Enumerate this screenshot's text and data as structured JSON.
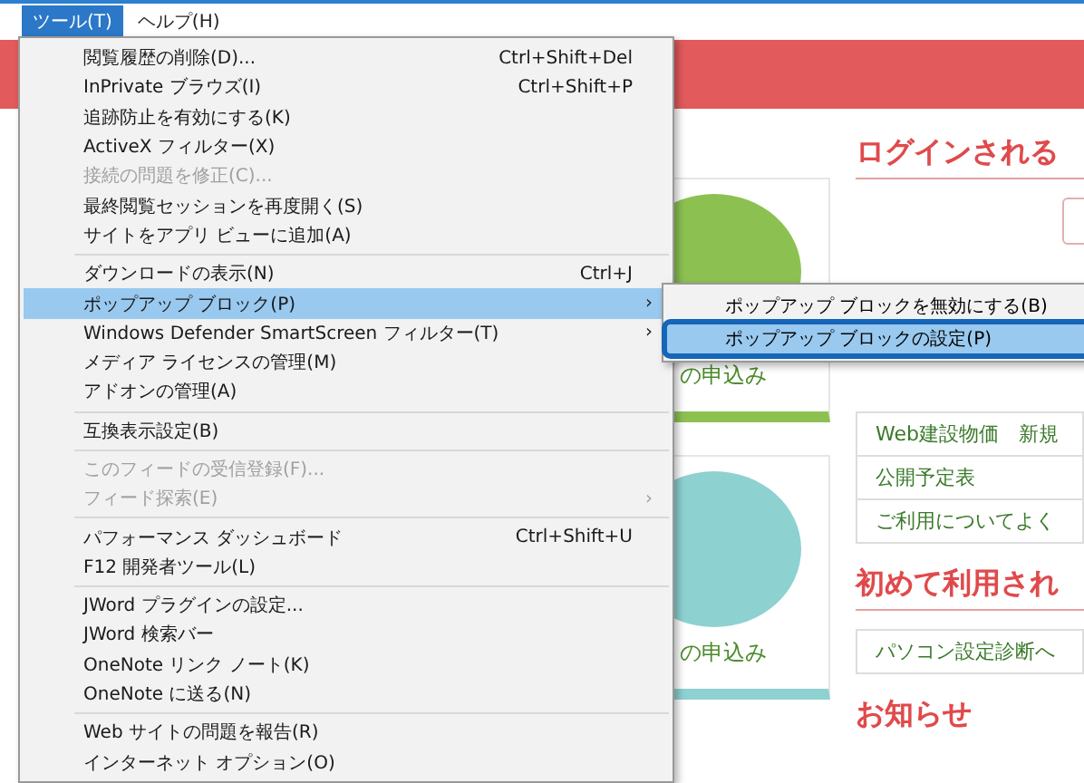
{
  "menubar": [
    {
      "label": "ツール(T)",
      "selected": true
    },
    {
      "label": "ヘルプ(H)",
      "selected": false
    }
  ],
  "menu": [
    {
      "kind": "item",
      "label": "閲覧履歴の削除(D)...",
      "shortcut": "Ctrl+Shift+Del",
      "disabled": false,
      "selected": false
    },
    {
      "kind": "item",
      "label": "InPrivate ブラウズ(I)",
      "shortcut": "Ctrl+Shift+P",
      "disabled": false,
      "selected": false
    },
    {
      "kind": "item",
      "label": "追跡防止を有効にする(K)",
      "disabled": false,
      "selected": false
    },
    {
      "kind": "item",
      "label": "ActiveX フィルター(X)",
      "disabled": false,
      "selected": false
    },
    {
      "kind": "item",
      "label": "接続の問題を修正(C)...",
      "disabled": true,
      "selected": false
    },
    {
      "kind": "item",
      "label": "最終閲覧セッションを再度開く(S)",
      "disabled": false,
      "selected": false
    },
    {
      "kind": "item",
      "label": "サイトをアプリ ビューに追加(A)",
      "disabled": false,
      "selected": false
    },
    {
      "kind": "separator"
    },
    {
      "kind": "item",
      "label": "ダウンロードの表示(N)",
      "shortcut": "Ctrl+J",
      "disabled": false,
      "selected": false
    },
    {
      "kind": "item",
      "label": "ポップアップ ブロック(P)",
      "arrow": "›",
      "disabled": false,
      "selected": true
    },
    {
      "kind": "item",
      "label": "Windows Defender SmartScreen フィルター(T)",
      "arrow": "›",
      "disabled": false,
      "selected": false
    },
    {
      "kind": "item",
      "label": "メディア ライセンスの管理(M)",
      "disabled": false,
      "selected": false
    },
    {
      "kind": "item",
      "label": "アドオンの管理(A)",
      "disabled": false,
      "selected": false
    },
    {
      "kind": "separator"
    },
    {
      "kind": "item",
      "label": "互換表示設定(B)",
      "disabled": false,
      "selected": false
    },
    {
      "kind": "separator"
    },
    {
      "kind": "item",
      "label": "このフィードの受信登録(F)...",
      "disabled": true,
      "selected": false
    },
    {
      "kind": "item",
      "label": "フィード探索(E)",
      "arrow": "›",
      "disabled": true,
      "selected": false
    },
    {
      "kind": "separator"
    },
    {
      "kind": "item",
      "label": "パフォーマンス ダッシュボード",
      "shortcut": "Ctrl+Shift+U",
      "disabled": false,
      "selected": false
    },
    {
      "kind": "item",
      "label": "F12 開発者ツール(L)",
      "disabled": false,
      "selected": false
    },
    {
      "kind": "separator"
    },
    {
      "kind": "item",
      "label": "JWord プラグインの設定...",
      "disabled": false,
      "selected": false
    },
    {
      "kind": "item",
      "label": "JWord 検索バー",
      "disabled": false,
      "selected": false
    },
    {
      "kind": "item",
      "label": "OneNote リンク ノート(K)",
      "disabled": false,
      "selected": false
    },
    {
      "kind": "item",
      "label": "OneNote に送る(N)",
      "disabled": false,
      "selected": false
    },
    {
      "kind": "separator"
    },
    {
      "kind": "item",
      "label": "Web サイトの問題を報告(R)",
      "disabled": false,
      "selected": false
    },
    {
      "kind": "item",
      "label": "インターネット オプション(O)",
      "disabled": false,
      "selected": false
    }
  ],
  "submenu": [
    {
      "label": "ポップアップ ブロックを無効にする(B)",
      "selected": false
    },
    {
      "label": "ポップアップ ブロックの設定(P)",
      "selected": true
    }
  ],
  "page": {
    "login_heading": "ログインされる",
    "cards": [
      {
        "caption": "の申込み",
        "color": "#8cc152"
      },
      {
        "caption": "の申込み",
        "color": "#8ed1d1"
      }
    ],
    "links": [
      "Web建設物価　新規",
      "公開予定表",
      "ご利用についてよく"
    ],
    "first_use_heading": "初めて利用され",
    "first_use_links": [
      "パソコン設定診断へ"
    ],
    "news_heading": "お知らせ"
  }
}
